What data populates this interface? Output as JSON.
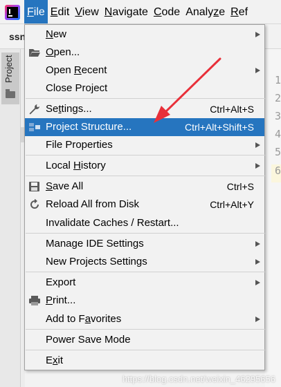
{
  "menubar": {
    "items": [
      {
        "label": "File",
        "mnemonic": "F",
        "rest": "ile"
      },
      {
        "label": "Edit",
        "mnemonic": "E",
        "rest": "dit"
      },
      {
        "label": "View",
        "mnemonic": "V",
        "rest": "iew"
      },
      {
        "label": "Navigate",
        "mnemonic": "N",
        "rest": "avigate"
      },
      {
        "label": "Code",
        "mnemonic": "C",
        "rest": "ode"
      },
      {
        "label": "Analyze",
        "pre": "Analy",
        "mnemonic": "z",
        "rest": "e"
      },
      {
        "label": "Ref",
        "mnemonic": "R",
        "rest": "ef"
      }
    ]
  },
  "editor": {
    "tab_fragment": "ssn",
    "side_tab": "Project",
    "line_numbers": [
      "1",
      "2",
      "3",
      "4",
      "5",
      "6"
    ]
  },
  "file_menu": {
    "items": [
      {
        "pre": "",
        "mnemonic": "N",
        "post": "ew",
        "shortcut": "",
        "submenu": true,
        "icon": ""
      },
      {
        "pre": "",
        "mnemonic": "O",
        "post": "pen...",
        "shortcut": "",
        "submenu": false,
        "icon": "folder-open-icon"
      },
      {
        "pre": "Open ",
        "mnemonic": "R",
        "post": "ecent",
        "shortcut": "",
        "submenu": true,
        "icon": ""
      },
      {
        "pre": "Close Project",
        "mnemonic": "",
        "post": "",
        "shortcut": "",
        "submenu": false,
        "icon": ""
      },
      {
        "pre": "Se",
        "mnemonic": "t",
        "post": "tings...",
        "shortcut": "Ctrl+Alt+S",
        "submenu": false,
        "icon": "wrench-icon"
      },
      {
        "pre": "Project Structure...",
        "mnemonic": "",
        "post": "",
        "shortcut": "Ctrl+Alt+Shift+S",
        "submenu": false,
        "icon": "project-structure-icon",
        "selected": true
      },
      {
        "pre": "File Properties",
        "mnemonic": "",
        "post": "",
        "shortcut": "",
        "submenu": true,
        "icon": ""
      },
      {
        "pre": "Local ",
        "mnemonic": "H",
        "post": "istory",
        "shortcut": "",
        "submenu": true,
        "icon": ""
      },
      {
        "pre": "",
        "mnemonic": "S",
        "post": "ave All",
        "shortcut": "Ctrl+S",
        "submenu": false,
        "icon": "save-icon"
      },
      {
        "pre": "Reload All from Disk",
        "mnemonic": "",
        "post": "",
        "shortcut": "Ctrl+Alt+Y",
        "submenu": false,
        "icon": "reload-icon"
      },
      {
        "pre": "Invalidate Caches / Restart...",
        "mnemonic": "",
        "post": "",
        "shortcut": "",
        "submenu": false,
        "icon": ""
      },
      {
        "pre": "Manage IDE Settings",
        "mnemonic": "",
        "post": "",
        "shortcut": "",
        "submenu": true,
        "icon": ""
      },
      {
        "pre": "New Projects Settings",
        "mnemonic": "",
        "post": "",
        "shortcut": "",
        "submenu": true,
        "icon": ""
      },
      {
        "pre": "Export",
        "mnemonic": "",
        "post": "",
        "shortcut": "",
        "submenu": true,
        "icon": ""
      },
      {
        "pre": "",
        "mnemonic": "P",
        "post": "rint...",
        "shortcut": "",
        "submenu": false,
        "icon": "print-icon"
      },
      {
        "pre": "Add to F",
        "mnemonic": "a",
        "post": "vorites",
        "shortcut": "",
        "submenu": true,
        "icon": ""
      },
      {
        "pre": "Power Save Mode",
        "mnemonic": "",
        "post": "",
        "shortcut": "",
        "submenu": false,
        "icon": ""
      },
      {
        "pre": "E",
        "mnemonic": "x",
        "post": "it",
        "shortcut": "",
        "submenu": false,
        "icon": ""
      }
    ]
  },
  "watermark": "https://blog.csdn.net/weixin_46295656",
  "colors": {
    "selection": "#2675bf",
    "annotation_arrow": "#e8303a",
    "menu_background": "#f2f2f2"
  }
}
